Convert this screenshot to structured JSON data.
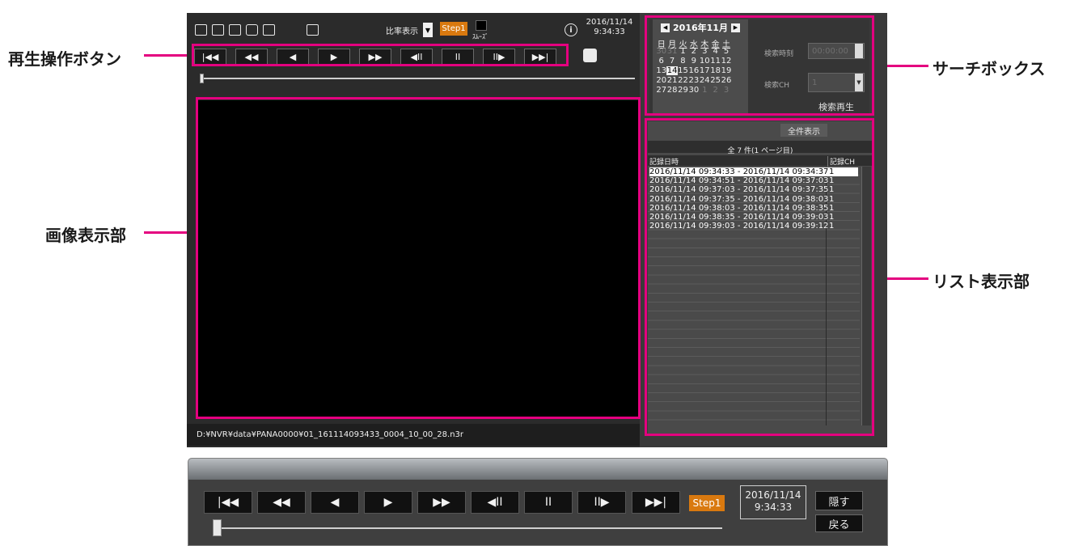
{
  "callouts": {
    "playback_buttons": "再生操作ボタン",
    "image_area": "画像表示部",
    "search_box": "サーチボックス",
    "list_area": "リスト表示部"
  },
  "toolbar": {
    "icons": [
      "open-file-icon",
      "open-folder-icon",
      "save-icon",
      "print-icon",
      "fit-window-icon",
      "fullscreen-icon"
    ],
    "display_mode_label": "比率表示",
    "step_label": "Step1",
    "smooth_label": "ｽﾑｰｽﾞ",
    "info_icon": "info-icon",
    "date": "2016/11/14",
    "time": "9:34:33"
  },
  "playback": {
    "buttons": [
      "|◀◀",
      "◀◀",
      "◀",
      "▶",
      "▶▶",
      "◀II",
      "II",
      "II▶",
      "▶▶|"
    ],
    "position_fraction": 0.0
  },
  "viewer": {
    "file_path": "D:¥NVR¥data¥PANA0000¥01_161114093433_0004_10_00_28.n3r"
  },
  "calendar": {
    "title": "2016年11月",
    "weekdays": [
      "日",
      "月",
      "火",
      "水",
      "木",
      "金",
      "土"
    ],
    "weeks": [
      [
        "30",
        "31",
        "1",
        "2",
        "3",
        "4",
        "5"
      ],
      [
        "6",
        "7",
        "8",
        "9",
        "10",
        "11",
        "12"
      ],
      [
        "13",
        "14",
        "15",
        "16",
        "17",
        "18",
        "19"
      ],
      [
        "20",
        "21",
        "22",
        "23",
        "24",
        "25",
        "26"
      ],
      [
        "27",
        "28",
        "29",
        "30",
        "1",
        "2",
        "3"
      ]
    ],
    "selected_day": "14"
  },
  "search": {
    "time_label": "検索時刻",
    "time_value": "00:00:00",
    "ch_label": "検索CH",
    "ch_value": "1",
    "play_button": "検索再生"
  },
  "list": {
    "show_all_button": "全件表示",
    "summary": "全 7 件(1 ページ目)",
    "col_datetime": "記録日時",
    "col_ch": "記録CH",
    "rows": [
      {
        "range": "2016/11/14 09:34:33 - 2016/11/14 09:34:37",
        "ch": "1"
      },
      {
        "range": "2016/11/14 09:34:51 - 2016/11/14 09:37:03",
        "ch": "1"
      },
      {
        "range": "2016/11/14 09:37:03 - 2016/11/14 09:37:35",
        "ch": "1"
      },
      {
        "range": "2016/11/14 09:37:35 - 2016/11/14 09:38:03",
        "ch": "1"
      },
      {
        "range": "2016/11/14 09:38:03 - 2016/11/14 09:38:35",
        "ch": "1"
      },
      {
        "range": "2016/11/14 09:38:35 - 2016/11/14 09:39:03",
        "ch": "1"
      },
      {
        "range": "2016/11/14 09:39:03 - 2016/11/14 09:39:12",
        "ch": "1"
      }
    ]
  },
  "bottom_bar": {
    "buttons": [
      "|◀◀",
      "◀◀",
      "◀",
      "▶",
      "▶▶",
      "◀II",
      "II",
      "II▶",
      "▶▶|"
    ],
    "step_label": "Step1",
    "date": "2016/11/14",
    "time": "9:34:33",
    "hide_button": "隠す",
    "back_button": "戻る"
  }
}
